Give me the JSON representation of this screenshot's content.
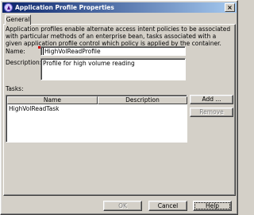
{
  "window": {
    "title": "Application Profile Properties",
    "close_symbol": "×"
  },
  "tabs": [
    {
      "label": "General"
    }
  ],
  "general": {
    "description_text": "Application profiles enable alternate access intent policies to be associated with particular methods of an enterprise bean, tasks associated with a given application profile control which policy is applied by the container.",
    "name_label": "Name:",
    "name_value": "HighVolReadProfile",
    "description_label": "Description:",
    "description_value": "Profile for high volume reading",
    "tasks_label": "Tasks:",
    "tasks_table": {
      "columns": [
        "Name",
        "Description"
      ],
      "rows": [
        {
          "name": "HighVolReadTask",
          "description": ""
        }
      ]
    },
    "add_button": "Add ...",
    "remove_button": "Remove"
  },
  "footer": {
    "ok_button": "OK",
    "cancel_button": "Cancel",
    "help_button": "Help"
  },
  "icons": {
    "app_icon": "app-profile-icon",
    "close_icon": "close-icon"
  },
  "colors": {
    "titlebar_start": "#0a246a",
    "titlebar_end": "#a6caf0",
    "dialog_bg": "#d4d0c8",
    "required_marker": "#d00000"
  }
}
